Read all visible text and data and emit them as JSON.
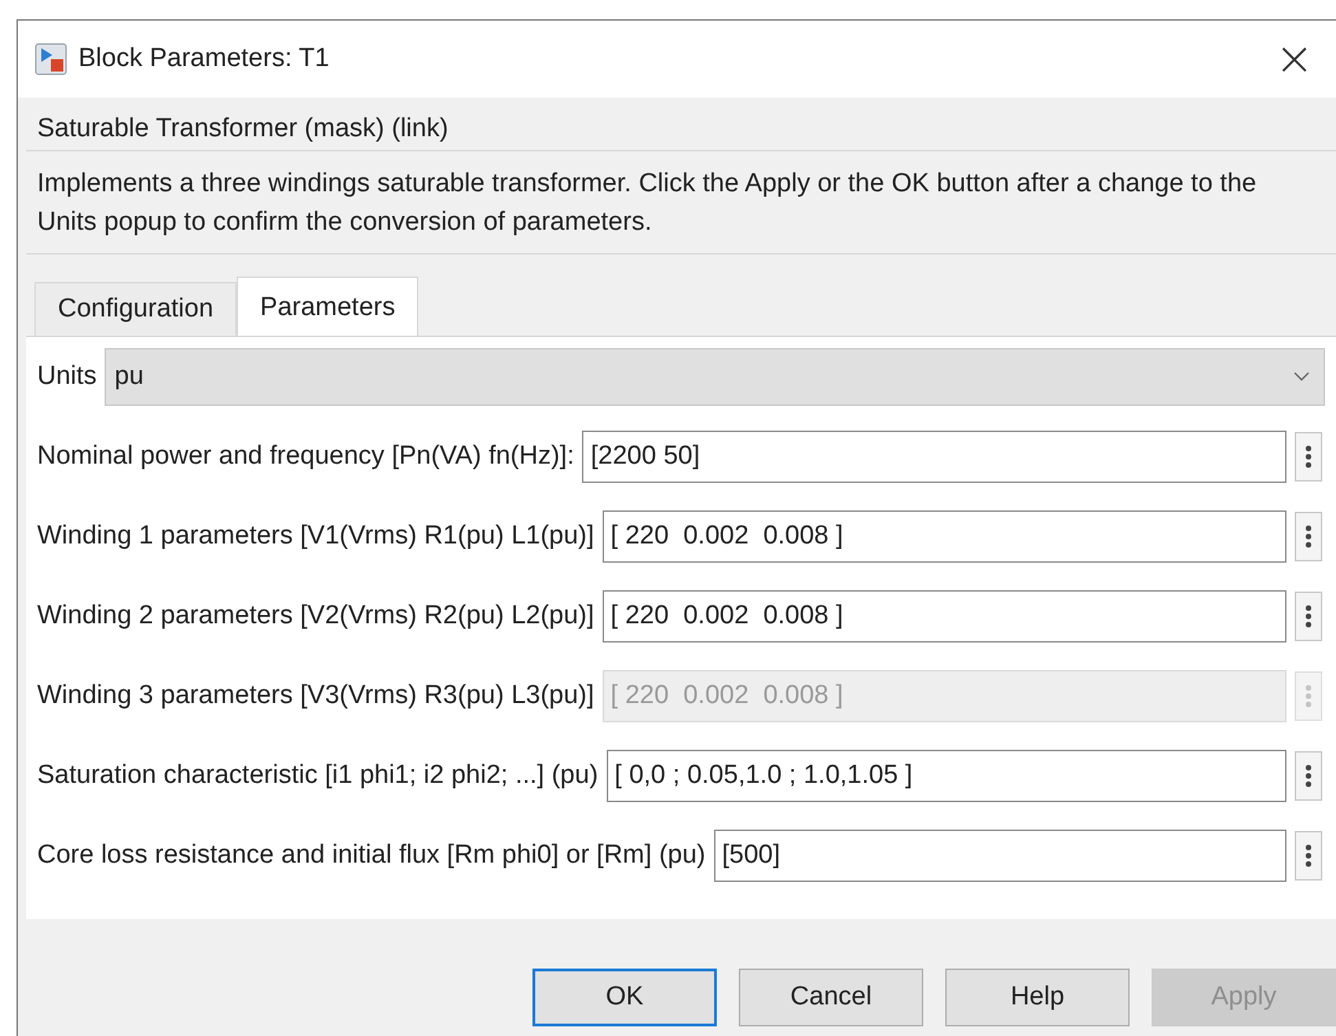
{
  "window": {
    "title": "Block Parameters: T1",
    "close": "×"
  },
  "group_title": "Saturable Transformer (mask) (link)",
  "description": "Implements a three windings saturable transformer. Click the Apply or the OK button after a change to the Units popup to confirm the conversion of parameters.",
  "tabs": [
    {
      "label": "Configuration",
      "selected": false
    },
    {
      "label": "Parameters",
      "selected": true
    }
  ],
  "units": {
    "label": "Units",
    "value": "pu"
  },
  "parameters": [
    {
      "label": "Nominal power and frequency [Pn(VA) fn(Hz)]:",
      "value": "[2200 50]",
      "disabled": false
    },
    {
      "label": "Winding 1 parameters [V1(Vrms) R1(pu) L1(pu)]",
      "value": "[ 220  0.002  0.008 ]",
      "disabled": false
    },
    {
      "label": "Winding 2 parameters [V2(Vrms) R2(pu) L2(pu)]",
      "value": "[ 220  0.002  0.008 ]",
      "disabled": false
    },
    {
      "label": "Winding 3 parameters [V3(Vrms) R3(pu) L3(pu)]",
      "value": "[ 220  0.002  0.008 ]",
      "disabled": true
    },
    {
      "label": "Saturation characteristic [i1 phi1; i2 phi2; ...] (pu)",
      "value": "[ 0,0 ; 0.05,1.0 ; 1.0,1.05 ]",
      "disabled": false
    },
    {
      "label": "Core loss resistance and initial flux [Rm phi0] or [Rm] (pu)",
      "value": "[500]",
      "disabled": false
    }
  ],
  "buttons": [
    {
      "label": "OK",
      "focused": true,
      "disabled": false
    },
    {
      "label": "Cancel",
      "focused": false,
      "disabled": false
    },
    {
      "label": "Help",
      "focused": false,
      "disabled": false
    },
    {
      "label": "Apply",
      "focused": false,
      "disabled": true
    }
  ]
}
